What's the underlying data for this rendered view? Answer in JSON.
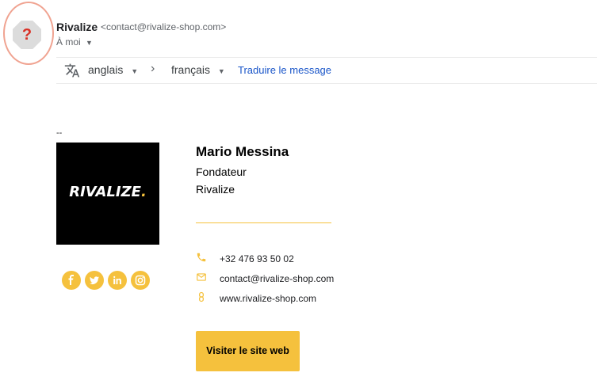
{
  "sender": {
    "name": "Rivalize",
    "email": "<contact@rivalize-shop.com>",
    "recipient": "À moi",
    "avatar_glyph": "?"
  },
  "translate_bar": {
    "source_language": "anglais",
    "target_language": "français",
    "translate_link": "Traduire le message"
  },
  "signature": {
    "separator": "--",
    "logo_text": "RIVALIZE",
    "logo_dot": ".",
    "name": "Mario Messina",
    "role": "Fondateur",
    "company": "Rivalize",
    "phone": "+32 476 93 50 02",
    "email": "contact@rivalize-shop.com",
    "website": "www.rivalize-shop.com",
    "cta_label": "Visiter le site web",
    "social_icons": [
      "facebook-icon",
      "twitter-icon",
      "linkedin-icon",
      "instagram-icon"
    ]
  },
  "colors": {
    "accent": "#f5c13d",
    "link": "#1a56c9",
    "avatar_ring": "#f0a391",
    "avatar_mark": "#d93025"
  }
}
